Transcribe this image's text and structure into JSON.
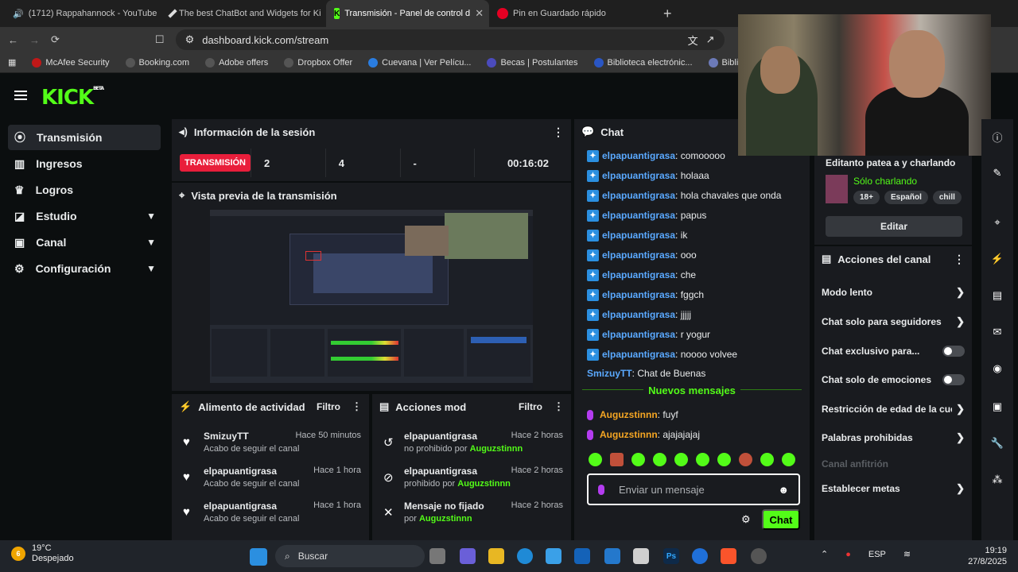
{
  "browser": {
    "tabs": [
      {
        "label": "(1712) Rappahannock - YouTube"
      },
      {
        "label": "The best ChatBot and Widgets for Ki"
      },
      {
        "label": "Transmisión - Panel de control d"
      },
      {
        "label": "Pin en Guardado rápido"
      }
    ],
    "url": "dashboard.kick.com/stream",
    "bookmarks": [
      "McAfee Security",
      "Booking.com",
      "Adobe offers",
      "Dropbox Offer",
      "Cuevana | Ver Pelícu...",
      "Becas | Postulantes",
      "Biblioteca electrónic...",
      "Biblioteca Génesis"
    ]
  },
  "sidebar": {
    "items": [
      {
        "label": "Transmisión"
      },
      {
        "label": "Ingresos"
      },
      {
        "label": "Logros"
      },
      {
        "label": "Estudio"
      },
      {
        "label": "Canal"
      },
      {
        "label": "Configuración"
      }
    ]
  },
  "session": {
    "title": "Información de la sesión",
    "badge": "TRANSMISIÓN",
    "stats": [
      "2",
      "4",
      "-",
      "00:16:02"
    ]
  },
  "preview": {
    "title": "Vista previa de la transmisión"
  },
  "feed": {
    "title": "Alimento de actividad",
    "filter": "Filtro",
    "items": [
      {
        "name": "SmizuyTT",
        "sub": "Acabo de seguir el canal",
        "time": "Hace 50 minutos"
      },
      {
        "name": "elpapuantigrasa",
        "sub": "Acabo de seguir el canal",
        "time": "Hace 1 hora"
      },
      {
        "name": "elpapuantigrasa",
        "sub": "Acabo de seguir el canal",
        "time": "Hace 1 hora"
      }
    ]
  },
  "mod": {
    "title": "Acciones mod",
    "filter": "Filtro",
    "items": [
      {
        "name": "elpapuantigrasa",
        "sub": "no prohibido por",
        "by": "Auguzstinnn",
        "time": "Hace 2 horas"
      },
      {
        "name": "elpapuantigrasa",
        "sub": "prohibido por",
        "by": "Auguzstinnn",
        "time": "Hace 2 horas"
      },
      {
        "name": "Mensaje no fijado",
        "sub": "por",
        "by": "Auguzstinnn",
        "time": "Hace 2 horas"
      }
    ]
  },
  "chat": {
    "title": "Chat",
    "messages": [
      {
        "user": "elpapuantigrasa",
        "text": ": comooooo"
      },
      {
        "user": "elpapuantigrasa",
        "text": ": holaaa"
      },
      {
        "user": "elpapuantigrasa",
        "text": ": hola chavales que onda"
      },
      {
        "user": "elpapuantigrasa",
        "text": ": papus"
      },
      {
        "user": "elpapuantigrasa",
        "text": ": ik"
      },
      {
        "user": "elpapuantigrasa",
        "text": ": ooo"
      },
      {
        "user": "elpapuantigrasa",
        "text": ": che"
      },
      {
        "user": "elpapuantigrasa",
        "text": ": fggch"
      },
      {
        "user": "elpapuantigrasa",
        "text": ": jjjjj"
      },
      {
        "user": "elpapuantigrasa",
        "text": ": r yogur"
      },
      {
        "user": "elpapuantigrasa",
        "text": ": noooo volvee"
      }
    ],
    "plain": {
      "user": "SmizuyTT",
      "text": ": Chat de Buenas"
    },
    "new_label": "Nuevos mensajes",
    "new_messages": [
      {
        "user": "Auguzstinnn",
        "text": ": fuyf"
      },
      {
        "user": "Auguzstinnn",
        "text": ": ajajajajaj"
      }
    ],
    "placeholder": "Enviar un mensaje",
    "send": "Chat"
  },
  "stream_info": {
    "title": "Editanto patea a y charlando",
    "category": "Sólo charlando",
    "tags": [
      "18+",
      "Español",
      "chill"
    ],
    "edit": "Editar"
  },
  "actions": {
    "title": "Acciones del canal",
    "items": [
      {
        "label": "Modo lento"
      },
      {
        "label": "Chat solo para seguidores"
      },
      {
        "label": "Chat exclusivo para..."
      },
      {
        "label": "Chat solo de emociones"
      },
      {
        "label": "Restricción de edad de la cue"
      },
      {
        "label": "Palabras prohibidas"
      },
      {
        "label": "Canal anfitrión"
      },
      {
        "label": "Establecer metas"
      }
    ]
  },
  "taskbar": {
    "temp": "19°C",
    "weather": "Despejado",
    "search": "Buscar",
    "lang": "ESP",
    "time": "19:19",
    "date": "27/8/2025",
    "weather_badge": "6"
  },
  "colors": {
    "accent": "#53fc18",
    "live": "#e91e3b",
    "panel": "#191b1f"
  }
}
